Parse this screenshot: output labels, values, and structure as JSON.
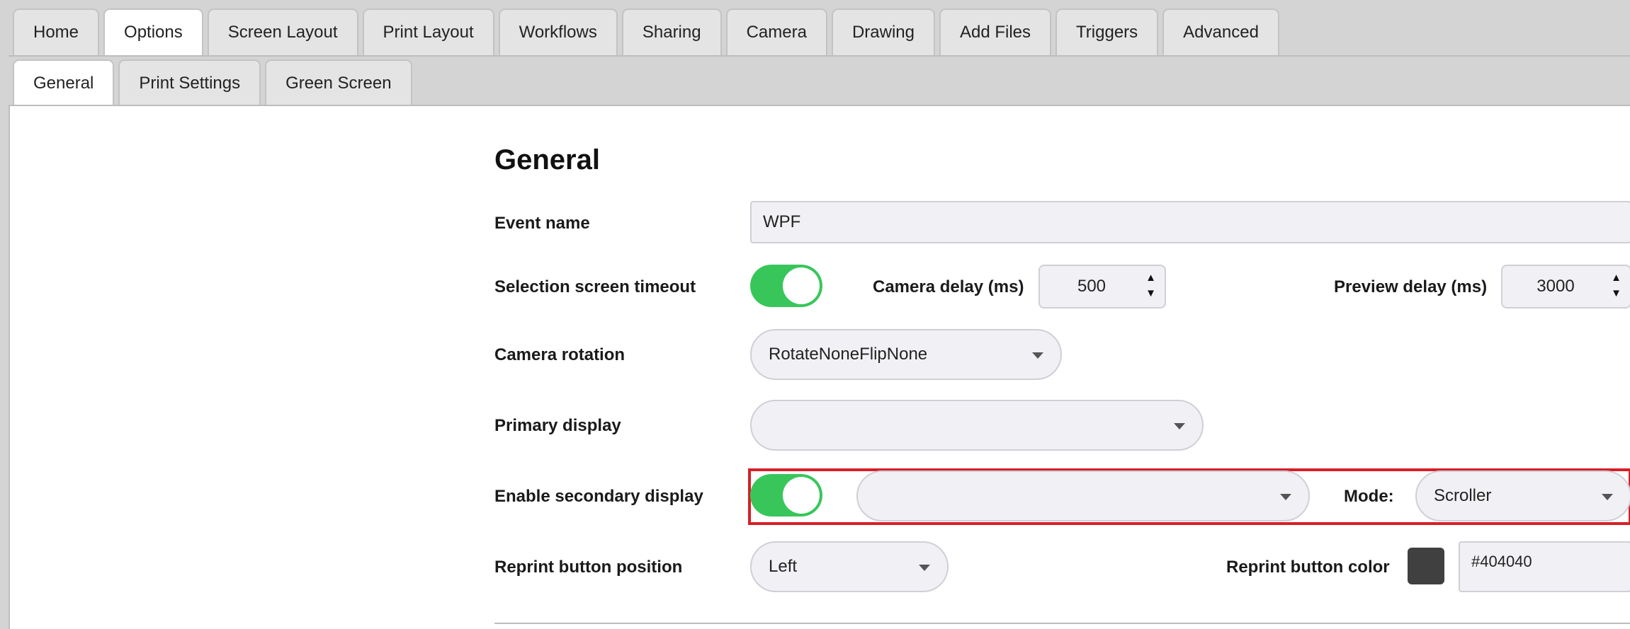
{
  "top_tabs": [
    "Home",
    "Options",
    "Screen Layout",
    "Print Layout",
    "Workflows",
    "Sharing",
    "Camera",
    "Drawing",
    "Add Files",
    "Triggers",
    "Advanced"
  ],
  "top_tabs_active": "Options",
  "sub_tabs": [
    "General",
    "Print Settings",
    "Green Screen"
  ],
  "sub_tabs_active": "General",
  "section_title": "General",
  "form": {
    "event_name_label": "Event name",
    "event_name_value": "WPF",
    "selection_timeout_label": "Selection screen timeout",
    "selection_timeout_on": true,
    "camera_delay_label": "Camera delay (ms)",
    "camera_delay_value": "500",
    "preview_delay_label": "Preview delay (ms)",
    "preview_delay_value": "3000",
    "camera_rotation_label": "Camera rotation",
    "camera_rotation_value": "RotateNoneFlipNone",
    "primary_display_label": "Primary display",
    "primary_display_value": "",
    "secondary_display_label": "Enable secondary display",
    "secondary_display_on": true,
    "secondary_display_value": "",
    "mode_label": "Mode:",
    "mode_value": "Scroller",
    "reprint_position_label": "Reprint button position",
    "reprint_position_value": "Left",
    "reprint_color_label": "Reprint button color",
    "reprint_color_value": "#404040"
  },
  "colors": {
    "toggle_on": "#38c65a",
    "highlight_border": "#d61f26",
    "reprint_swatch": "#404040"
  },
  "icons": {
    "dropdown": "caret-down",
    "spinner": "up-down-arrows"
  }
}
